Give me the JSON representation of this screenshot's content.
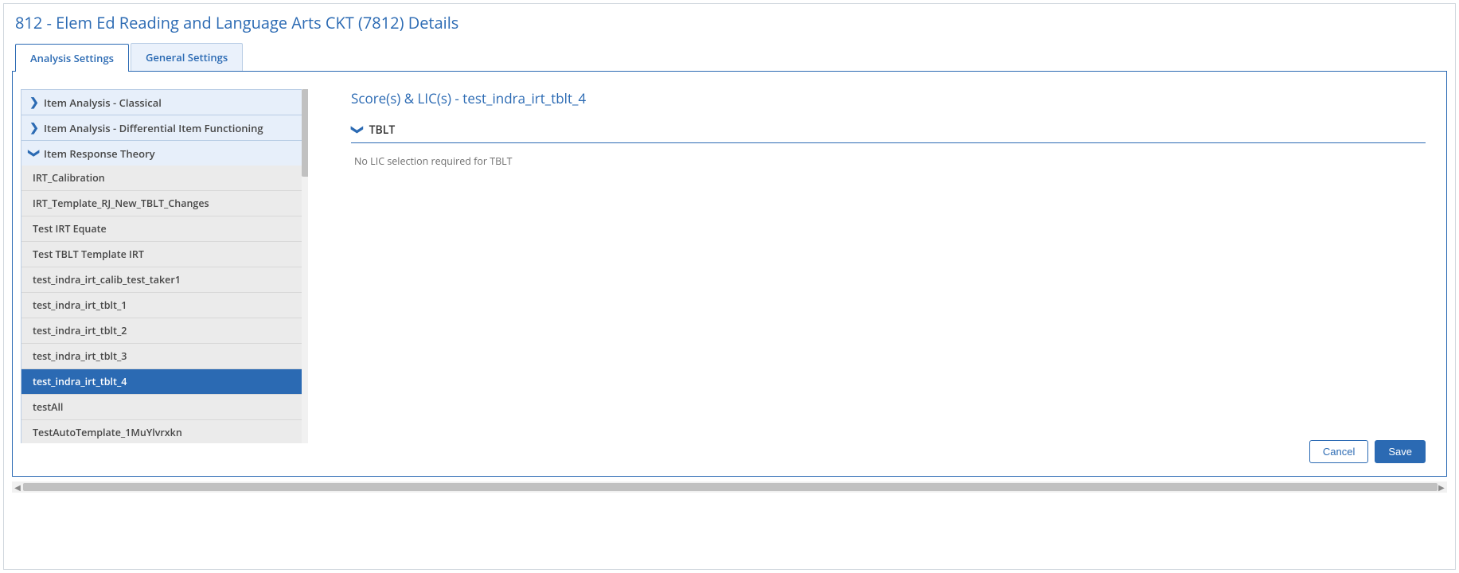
{
  "page": {
    "title": "812 - Elem Ed Reading and Language Arts CKT (7812) Details"
  },
  "tabs": {
    "analysis": "Analysis Settings",
    "general": "General Settings"
  },
  "sidebar": {
    "groups": [
      {
        "label": "Item Analysis - Classical",
        "expanded": false
      },
      {
        "label": "Item Analysis - Differential Item Functioning",
        "expanded": false
      },
      {
        "label": "Item Response Theory",
        "expanded": true
      }
    ],
    "irt_items": [
      "IRT_Calibration",
      "IRT_Template_RJ_New_TBLT_Changes",
      "Test IRT Equate",
      "Test TBLT Template IRT",
      "test_indra_irt_calib_test_taker1",
      "test_indra_irt_tblt_1",
      "test_indra_irt_tblt_2",
      "test_indra_irt_tblt_3",
      "test_indra_irt_tblt_4",
      "testAll",
      "TestAutoTemplate_1MuYlvrxkn"
    ],
    "selected_item": "test_indra_irt_tblt_4"
  },
  "main": {
    "heading": "Score(s) & LIC(s) - test_indra_irt_tblt_4",
    "section_label": "TBLT",
    "section_body": "No LIC selection required for TBLT"
  },
  "actions": {
    "cancel": "Cancel",
    "save": "Save"
  }
}
